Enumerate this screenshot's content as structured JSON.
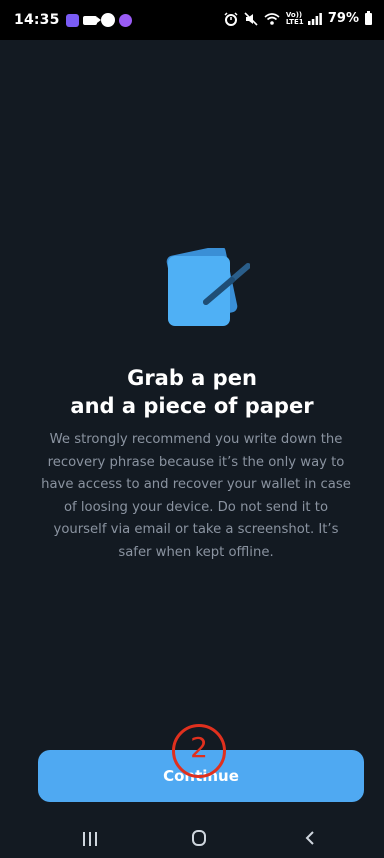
{
  "status_bar": {
    "time": "14:35",
    "battery": "79%",
    "left_icons": [
      "infinity-app-icon",
      "video-camera-icon",
      "chrome-icon",
      "infinity-circle-icon"
    ],
    "right_icons": [
      "alarm-icon",
      "mute-icon",
      "wifi-icon",
      "volte-icon",
      "signal-icon",
      "battery-icon"
    ],
    "network_label": "Vo)) LTE1"
  },
  "illustration": {
    "name": "pen-and-paper-icon",
    "colors": {
      "paper_back": "#3a8fd6",
      "paper_front": "#4fb0f5",
      "pen": "#2a5e8a"
    }
  },
  "heading": {
    "line1": "Grab a pen",
    "line2": "and a piece of paper"
  },
  "body": {
    "text": "We strongly recommend you write down the recovery phrase because it’s the only way to have access to and recover your wallet in case of loosing your device. Do not send it to yourself via email or take a screenshot. It’s safer when kept offline."
  },
  "continue_button": {
    "label": "Continue",
    "color": "#4fa9f2"
  },
  "annotation": {
    "number": "2",
    "color": "#e0301e"
  },
  "nav_bar": {
    "items": [
      "recent-apps-icon",
      "home-icon",
      "back-icon"
    ]
  }
}
